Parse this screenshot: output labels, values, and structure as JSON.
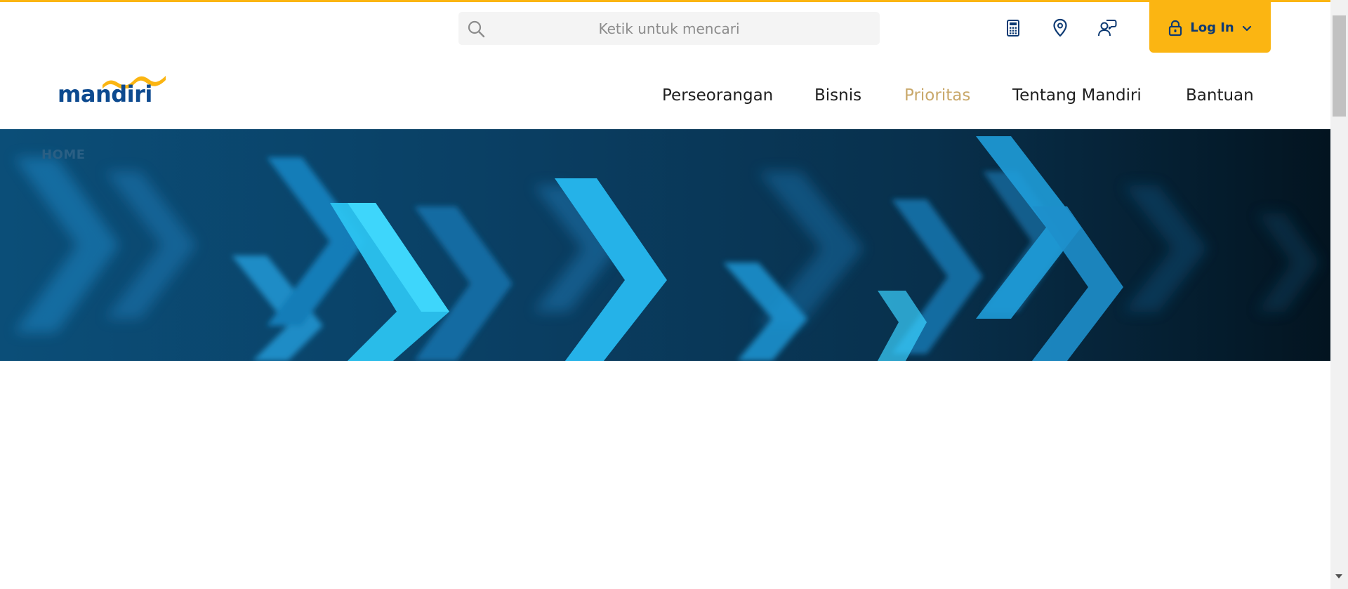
{
  "search": {
    "placeholder": "Ketik untuk mencari"
  },
  "utility_icons": [
    "calculator-icon",
    "location-pin-icon",
    "customer-support-icon"
  ],
  "login": {
    "label": "Log In"
  },
  "logo": {
    "text": "mandiri"
  },
  "nav": {
    "items": [
      {
        "label": "Perseorangan",
        "active": false
      },
      {
        "label": "Bisnis",
        "active": false
      },
      {
        "label": "Prioritas",
        "active": true
      },
      {
        "label": "Tentang Mandiri",
        "active": false
      },
      {
        "label": "Bantuan",
        "active": false
      }
    ]
  },
  "hero": {
    "breadcrumb": "HOME"
  },
  "colors": {
    "accent": "#fbb512",
    "brand_blue": "#0d4a8f",
    "active_nav": "#c9a86a"
  }
}
